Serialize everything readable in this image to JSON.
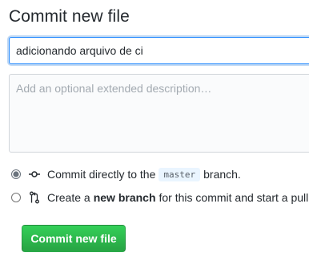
{
  "page": {
    "title": "Commit new file"
  },
  "form": {
    "summary_value": "adicionando arquivo de ci",
    "description_placeholder": "Add an optional extended description…",
    "description_value": ""
  },
  "options": [
    {
      "selected": true,
      "icon": "git-commit-icon",
      "text_before": "Commit directly to the",
      "code": "master",
      "text_after": "branch."
    },
    {
      "selected": false,
      "icon": "git-pull-request-icon",
      "text_before": "Create a",
      "bold": "new branch",
      "text_after": "for this commit and start a pull"
    }
  ],
  "actions": {
    "commit_label": "Commit new file"
  },
  "colors": {
    "accent_green": "#2ea44f",
    "focus_blue": "#2188ff",
    "code_bg": "#eaf5ff"
  }
}
